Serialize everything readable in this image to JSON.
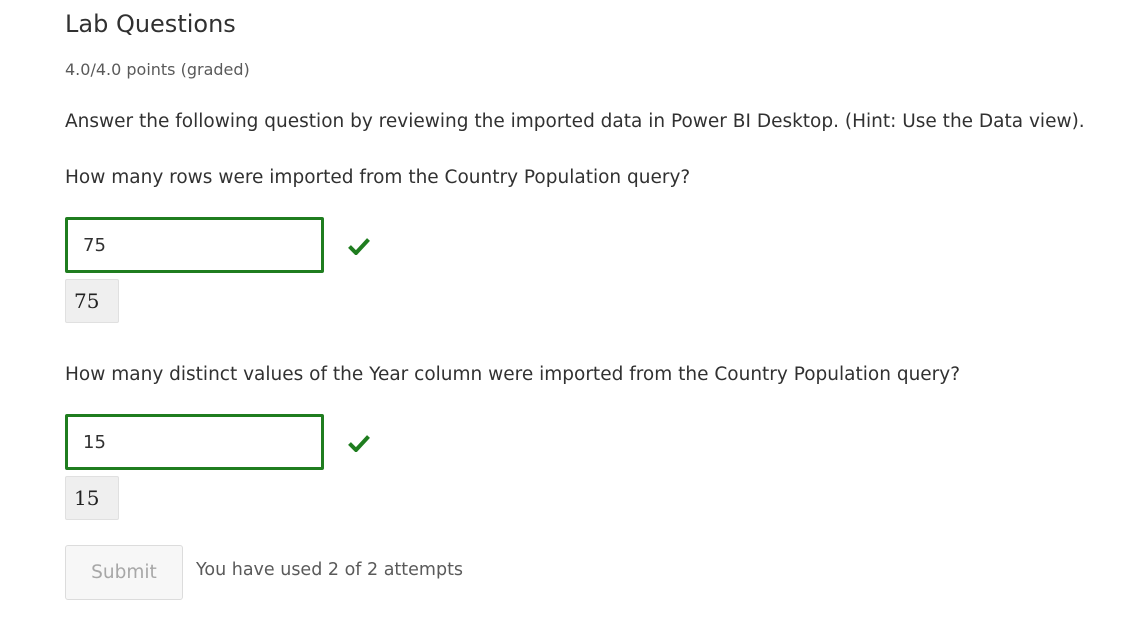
{
  "problem": {
    "title": "Lab Questions",
    "score": "4.0/4.0 points (graded)",
    "instructions": "Answer the following question by reviewing the imported data in Power BI Desktop. (Hint: Use the Data view)."
  },
  "questions": [
    {
      "text": "How many rows were imported from the Country Population query?",
      "answer": "75",
      "preview": "75",
      "status": "correct"
    },
    {
      "text": "How many distinct values of the Year column were imported from the Country Population query?",
      "answer": "15",
      "preview": "15",
      "status": "correct"
    }
  ],
  "footer": {
    "submit_label": "Submit",
    "attempts_text": "You have used 2 of 2 attempts"
  },
  "colors": {
    "correct": "#1f7d1f",
    "text": "#313131",
    "muted": "#5a5a5a"
  }
}
